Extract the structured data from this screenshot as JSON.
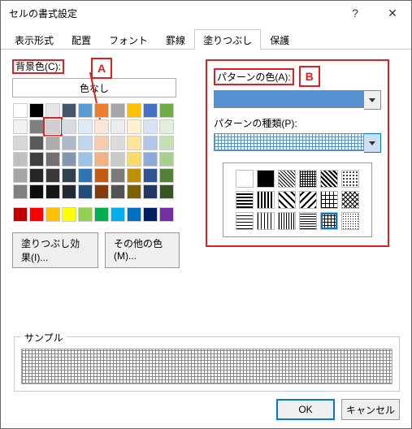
{
  "window": {
    "title": "セルの書式設定"
  },
  "tabs": [
    "表示形式",
    "配置",
    "フォント",
    "罫線",
    "塗りつぶし",
    "保護"
  ],
  "active_tab": "塗りつぶし",
  "bg": {
    "label": "背景色(C):",
    "no_color": "色なし",
    "annotation": "A",
    "row1": [
      "#FFFFFF",
      "#000000",
      "#E7E6E6",
      "#44546A",
      "#5B9BD5",
      "#ED7D31",
      "#A5A5A5",
      "#FFC000",
      "#4472C4",
      "#70AD47"
    ],
    "row2": [
      "#F2F2F2",
      "#808080",
      "#D0CECE",
      "#D6DCE4",
      "#DEEBF6",
      "#FBE5D5",
      "#EDEDED",
      "#FFF2CC",
      "#D9E2F3",
      "#E2EFD9"
    ],
    "row3": [
      "#D8D8D8",
      "#595959",
      "#AEABAB",
      "#ADB9CA",
      "#BDD7EE",
      "#F7CBAC",
      "#DBDBDB",
      "#FEE599",
      "#B4C6E7",
      "#C5E0B3"
    ],
    "row4": [
      "#BFBFBF",
      "#3F3F3F",
      "#757070",
      "#8496B0",
      "#9CC3E5",
      "#F4B183",
      "#C9C9C9",
      "#FFD965",
      "#8EAADB",
      "#A8D08D"
    ],
    "row5": [
      "#A5A5A5",
      "#262626",
      "#3A3838",
      "#323F4F",
      "#2E75B5",
      "#C55A11",
      "#7B7B7B",
      "#BF9000",
      "#2F5496",
      "#538135"
    ],
    "row6": [
      "#7F7F7F",
      "#0C0C0C",
      "#171616",
      "#222A35",
      "#1E4E79",
      "#833C0B",
      "#525252",
      "#7F6000",
      "#1F3864",
      "#375623"
    ],
    "std": [
      "#C00000",
      "#FF0000",
      "#FFC000",
      "#FFFF00",
      "#92D050",
      "#00B050",
      "#00B0F0",
      "#0070C0",
      "#002060",
      "#7030A0"
    ],
    "selected_index": 12
  },
  "pattern": {
    "color_label": "パターンの色(A):",
    "type_label": "パターンの種類(P):",
    "annotation": "B",
    "color_value": "#5591D0"
  },
  "buttons": {
    "fill_effects": "塗りつぶし効果(I)...",
    "more_colors": "その他の色(M)..."
  },
  "sample": {
    "label": "サンプル"
  },
  "footer": {
    "ok": "OK",
    "cancel": "キャンセル"
  }
}
